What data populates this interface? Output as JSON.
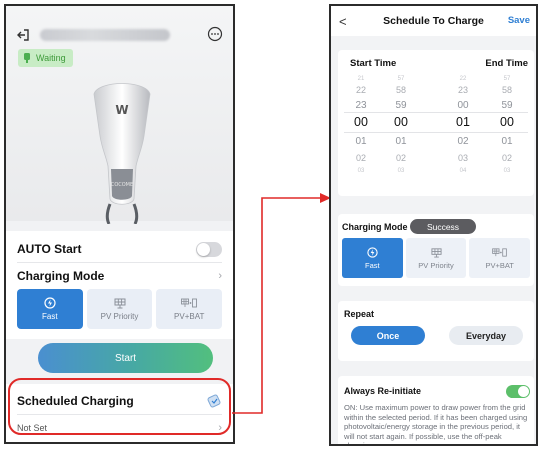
{
  "left_screen": {
    "status": "Waiting",
    "auto_start": {
      "label": "AUTO Start",
      "enabled": false
    },
    "charging_mode": {
      "label": "Charging Mode",
      "options": [
        "Fast",
        "PV Priority",
        "PV+BAT"
      ],
      "selected": "Fast"
    },
    "start_button": "Start",
    "scheduled_charging": {
      "label": "Scheduled Charging",
      "value": "Not Set"
    },
    "charger_logo": "W",
    "charger_brand": "COCOME"
  },
  "right_screen": {
    "header": {
      "back": "<",
      "title": "Schedule To Charge",
      "save": "Save"
    },
    "time_picker": {
      "start_label": "Start Time",
      "end_label": "End Time",
      "start_hours": [
        "21",
        "22",
        "23",
        "00",
        "01",
        "02",
        "03"
      ],
      "start_minutes": [
        "57",
        "58",
        "59",
        "00",
        "01",
        "02",
        "03"
      ],
      "end_hours": [
        "22",
        "23",
        "00",
        "01",
        "02",
        "03",
        "04"
      ],
      "end_minutes": [
        "57",
        "58",
        "59",
        "00",
        "01",
        "02",
        "03"
      ],
      "selected_start": "00:00",
      "selected_end": "01:00"
    },
    "charging_mode": {
      "label": "Charging Mode",
      "toast": "Success",
      "options": [
        "Fast",
        "PV Priority",
        "PV+BAT"
      ],
      "selected": "Fast"
    },
    "repeat": {
      "label": "Repeat",
      "options": [
        "Once",
        "Everyday"
      ],
      "selected": "Once"
    },
    "always_reinitiate": {
      "label": "Always Re-initiate",
      "enabled": true,
      "description": "ON: Use maximum power to draw power from the grid within the selected period. If it has been charged using photovoltaic/energy storage in the previous period, it will not start again. If possible, use the off-peak charging"
    }
  },
  "colors": {
    "accent": "#2f7fd3",
    "highlight": "#e02a28",
    "toggle_on": "#5cbf6a",
    "status_green": "#3e9b3a"
  }
}
